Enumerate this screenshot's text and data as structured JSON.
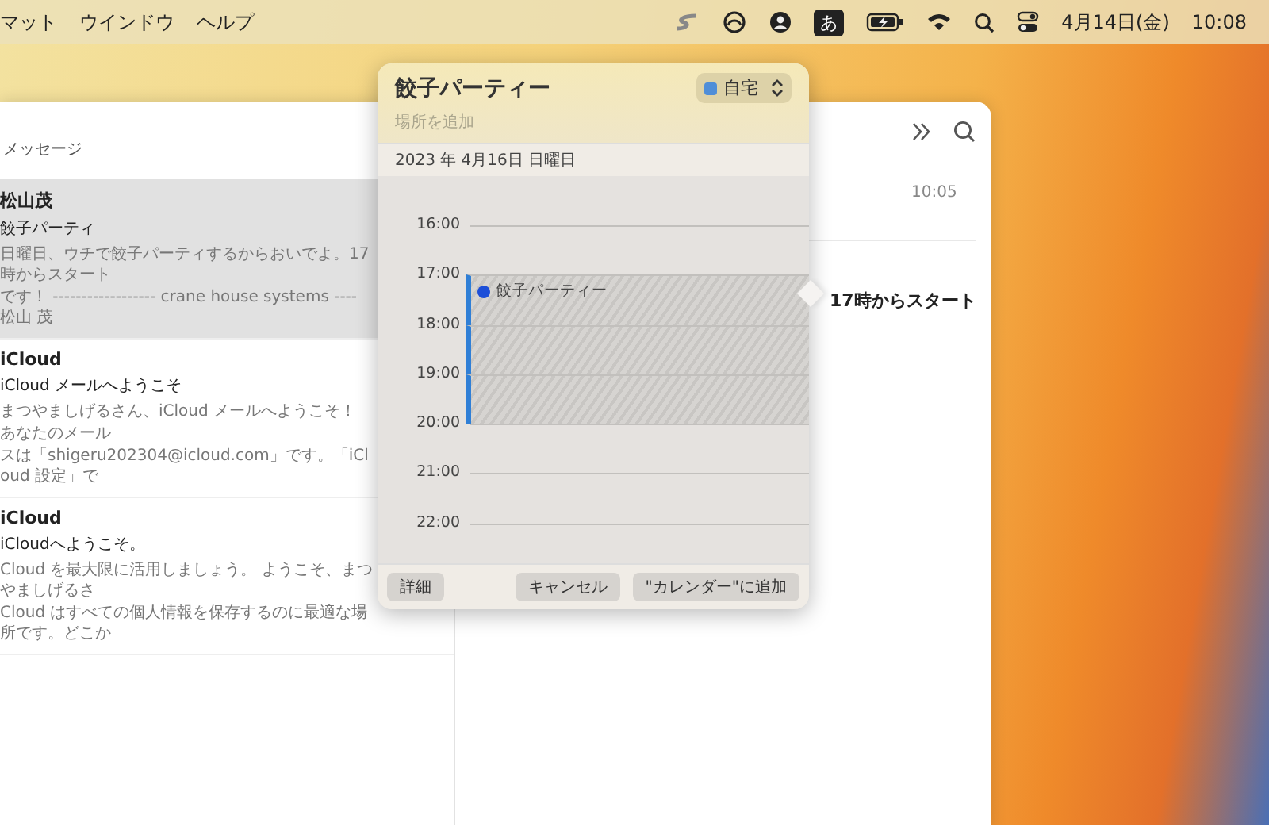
{
  "menu_bar": {
    "menus": [
      "マット",
      "ウインドウ",
      "ヘルプ"
    ],
    "input_mode": "あ",
    "date": "4月14日(金)",
    "time": "10:08"
  },
  "mail_list": {
    "title": "メッセージ",
    "messages": [
      {
        "sender": "松山茂",
        "subject": "餃子パーティ",
        "preview_lines": [
          "日曜日、ウチで餃子パーティするからおいでよ。17時からスタート",
          "です！ ------------------ crane house systems ---- 松山 茂"
        ],
        "selected": true
      },
      {
        "sender": "iCloud",
        "subject": "iCloud メールへようこそ",
        "preview_lines": [
          "まつやましげるさん、iCloud メールへようこそ！",
          "あなたのメール",
          "スは「shigeru202304@icloud.com」です。「iCloud 設定」で"
        ],
        "selected": false
      },
      {
        "sender": "iCloud",
        "subject": "iCloudへようこそ。",
        "preview_lines": [
          "Cloud を最大限に活用しましょう。 ようこそ、まつやましげるさ",
          "Cloud はすべての個人情報を保存するのに最適な場所です。どこか"
        ],
        "selected": false
      }
    ]
  },
  "message_view": {
    "time": "10:05",
    "body": "17時からスタート"
  },
  "event_popover": {
    "title": "餃子パーティー",
    "calendar": "自宅",
    "location_placeholder": "場所を追加",
    "date": "2023 年 4月16日 日曜日",
    "hours": [
      {
        "label": "16:00",
        "in_event": false
      },
      {
        "label": "17:00",
        "in_event": true
      },
      {
        "label": "18:00",
        "in_event": true
      },
      {
        "label": "19:00",
        "in_event": true
      },
      {
        "label": "20:00",
        "in_event": false
      },
      {
        "label": "21:00",
        "in_event": false
      },
      {
        "label": "22:00",
        "in_event": false
      }
    ],
    "event_title": "餃子パーティー",
    "buttons": [
      {
        "label": "詳細",
        "kind": "left"
      },
      {
        "label": "キャンセル",
        "kind": "right"
      },
      {
        "label": "\"カレンダー\"に追加",
        "kind": "right"
      }
    ]
  }
}
